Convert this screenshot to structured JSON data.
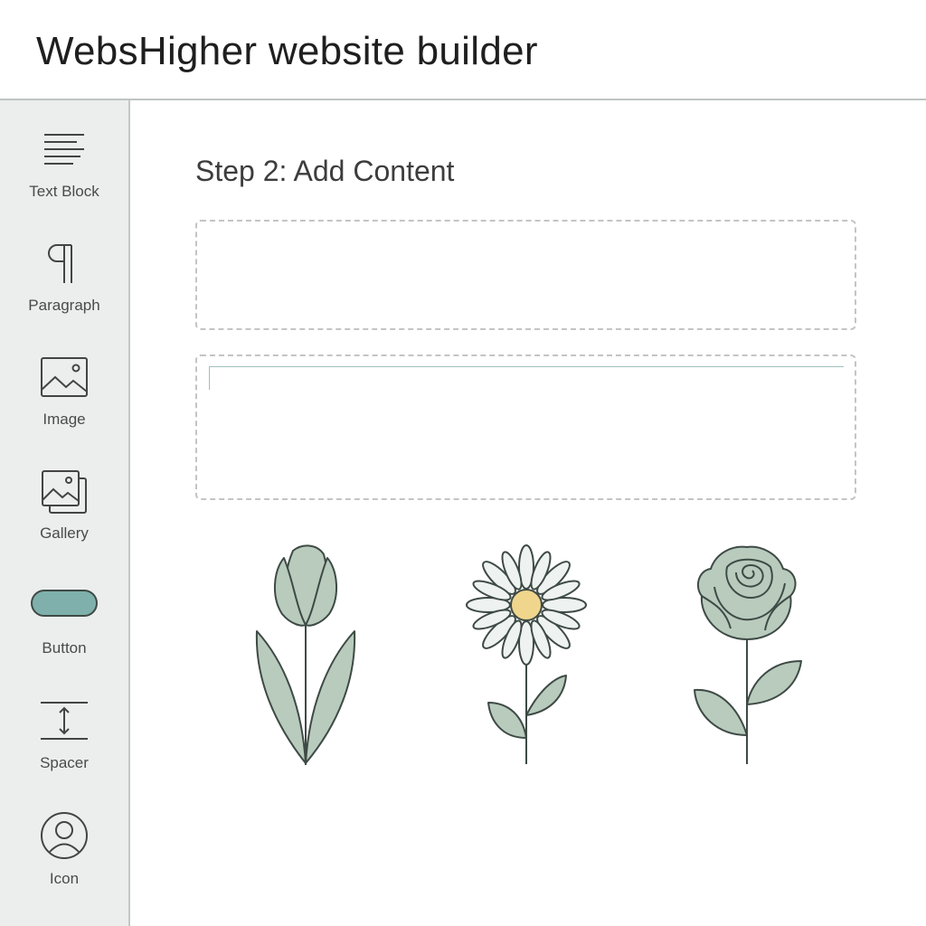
{
  "header": {
    "title": "WebsHigher website builder"
  },
  "sidebar": {
    "items": [
      {
        "label": "Text Block",
        "icon": "text-block-icon"
      },
      {
        "label": "Paragraph",
        "icon": "pilcrow-icon"
      },
      {
        "label": "Image",
        "icon": "image-icon"
      },
      {
        "label": "Gallery",
        "icon": "gallery-icon"
      },
      {
        "label": "Button",
        "icon": "button-shape-icon"
      },
      {
        "label": "Spacer",
        "icon": "spacer-icon"
      },
      {
        "label": "Icon",
        "icon": "user-circle-icon"
      }
    ]
  },
  "main": {
    "step_title": "Step 2: Add Content",
    "dropzones": 2,
    "illustrations": [
      "tulip",
      "daisy",
      "rose"
    ]
  },
  "colors": {
    "sidebar_bg": "#eceeee",
    "accent_teal": "#7fb0ac",
    "leaf_sage": "#b8cbbd",
    "daisy_center": "#f0d58c",
    "outline": "#3e4a45"
  }
}
